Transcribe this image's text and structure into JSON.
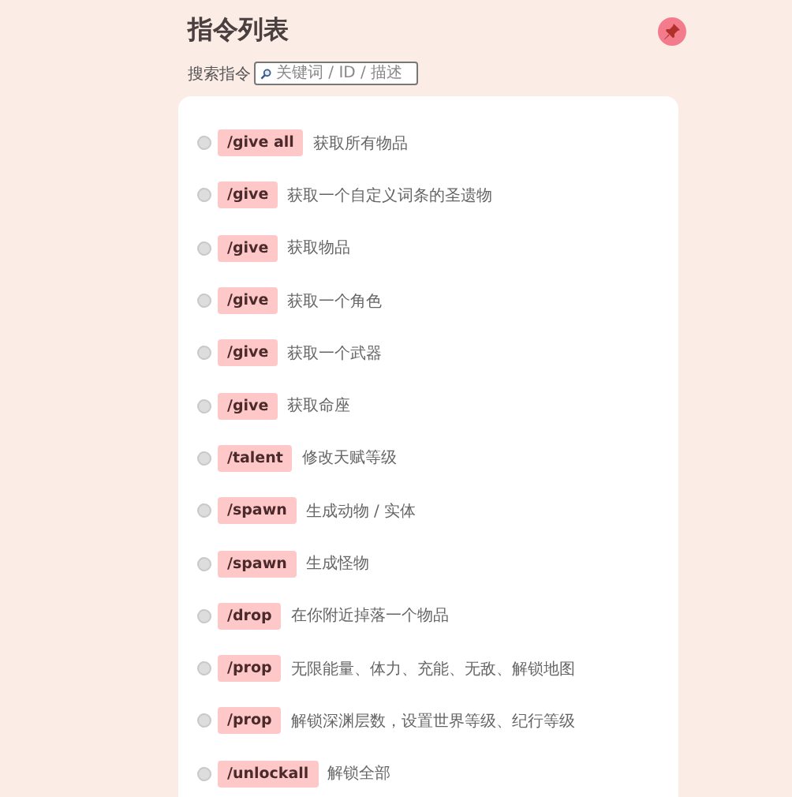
{
  "title": "指令列表",
  "search": {
    "label": "搜索指令",
    "placeholder": "关键词 / ID / 描述"
  },
  "commands": [
    {
      "command": "/give all",
      "description": "获取所有物品",
      "selected": false
    },
    {
      "command": "/give",
      "description": "获取一个自定义词条的圣遗物",
      "selected": false
    },
    {
      "command": "/give",
      "description": "获取物品",
      "selected": false
    },
    {
      "command": "/give",
      "description": "获取一个角色",
      "selected": false
    },
    {
      "command": "/give",
      "description": "获取一个武器",
      "selected": false
    },
    {
      "command": "/give",
      "description": "获取命座",
      "selected": false
    },
    {
      "command": "/talent",
      "description": "修改天赋等级",
      "selected": false
    },
    {
      "command": "/spawn",
      "description": "生成动物 / 实体",
      "selected": false
    },
    {
      "command": "/spawn",
      "description": "生成怪物",
      "selected": false
    },
    {
      "command": "/drop",
      "description": "在你附近掉落一个物品",
      "selected": false
    },
    {
      "command": "/prop",
      "description": "无限能量、体力、充能、无敌、解锁地图",
      "selected": false
    },
    {
      "command": "/prop",
      "description": "解锁深渊层数，设置世界等级、纪行等级",
      "selected": false
    },
    {
      "command": "/unlockall",
      "description": "解锁全部",
      "selected": false
    }
  ]
}
